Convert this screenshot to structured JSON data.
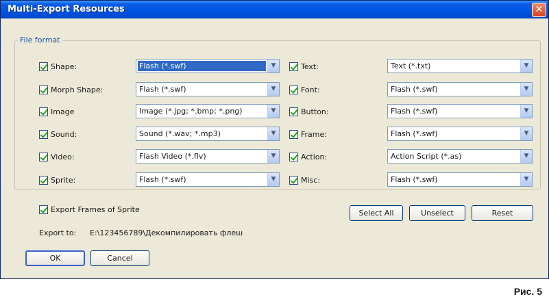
{
  "window": {
    "title": "Multi-Export Resources",
    "close_glyph": "✕"
  },
  "fieldset": {
    "legend": "File format"
  },
  "left_rows": [
    {
      "label": "Shape:",
      "value": "Flash (*.swf)",
      "selected": true
    },
    {
      "label": "Morph Shape:",
      "value": "Flash (*.swf)"
    },
    {
      "label": "Image",
      "value": "Image (*.jpg; *.bmp; *.png)"
    },
    {
      "label": "Sound:",
      "value": "Sound (*.wav; *.mp3)"
    },
    {
      "label": "Video:",
      "value": "Flash Video (*.flv)"
    },
    {
      "label": "Sprite:",
      "value": "Flash (*.swf)"
    }
  ],
  "right_rows": [
    {
      "label": "Text:",
      "value": "Text (*.txt)"
    },
    {
      "label": "Font:",
      "value": "Flash (*.swf)"
    },
    {
      "label": "Button:",
      "value": "Flash (*.swf)"
    },
    {
      "label": "Frame:",
      "value": "Flash (*.swf)"
    },
    {
      "label": "Action:",
      "value": "Action Script (*.as)"
    },
    {
      "label": "Misc:",
      "value": "Flash (*.swf)"
    }
  ],
  "export_frames": {
    "label": "Export Frames of Sprite"
  },
  "actions": {
    "select_all": "Select All",
    "unselect": "Unselect",
    "reset": "Reset"
  },
  "export_to": {
    "label": "Export to:",
    "path": "E:\\123456789\\Декомпилировать флеш"
  },
  "footer": {
    "ok": "OK",
    "cancel": "Cancel"
  },
  "caption": "Рис. 5",
  "icons": {
    "dropdown": "chevron-down-icon",
    "checkbox": "checkmark-icon"
  }
}
